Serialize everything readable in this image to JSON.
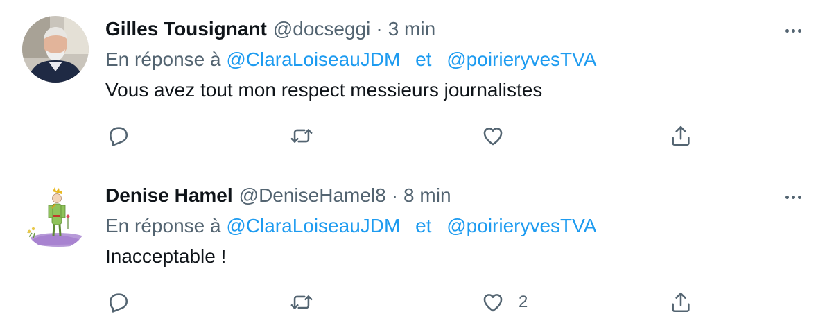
{
  "tweets": [
    {
      "name": "Gilles Tousignant",
      "handle": "@docseggi",
      "separator": "·",
      "time": "3 min",
      "reply_prefix": "En réponse à",
      "mention_1": "@ClaraLoiseauJDM",
      "conjunction": "et",
      "mention_2": "@poirieryvesTVA",
      "text": "Vous avez tout mon respect messieurs journalistes",
      "like_count": ""
    },
    {
      "name": "Denise Hamel",
      "handle": "@DeniseHamel8",
      "separator": "·",
      "time": "8 min",
      "reply_prefix": "En réponse à",
      "mention_1": "@ClaraLoiseauJDM",
      "conjunction": "et",
      "mention_2": "@poirieryvesTVA",
      "text": "Inacceptable !",
      "like_count": "2"
    }
  ],
  "icons": {
    "reply": "reply-icon",
    "retweet": "retweet-icon",
    "like": "heart-icon",
    "share": "share-icon",
    "more": "more-icon"
  },
  "colors": {
    "link": "#1d9bf0",
    "secondary_text": "#536471",
    "primary_text": "#0f1419"
  }
}
